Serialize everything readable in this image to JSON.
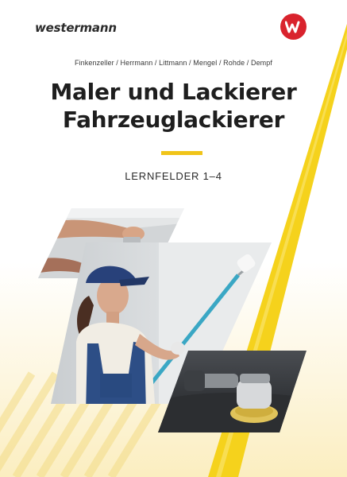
{
  "publisher": {
    "name": "westermann"
  },
  "book": {
    "authors": "Finkenzeller / Herrmann / Littmann / Mengel / Rohde / Dempf",
    "title_line1": "Maler und Lackierer",
    "title_line2": "Fahrzeuglackierer",
    "subtitle": "LERNFELDER 1–4"
  },
  "colors": {
    "accent_yellow": "#f0c419",
    "brand_red": "#d9232d",
    "text_dark": "#1e1e1e"
  },
  "images": [
    "hands-sanding-icon",
    "painter-girl-with-roller-icon",
    "orbital-polisher-icon"
  ]
}
